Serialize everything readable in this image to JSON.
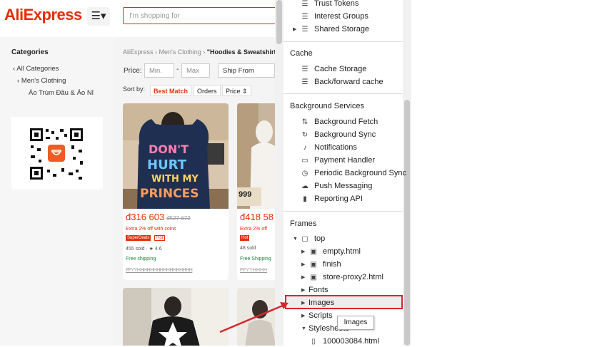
{
  "aliexpress": {
    "logo": "AliExpress",
    "menu_icon": "☰▾",
    "search_placeholder": "I'm shopping for",
    "categories_title": "Categories",
    "all_categories": "All Categories",
    "mens_clothing": "Men's Clothing",
    "subcategory": "Áo Trùm Đầu & Áo Nỉ",
    "breadcrumb": {
      "a": "AliExpress",
      "b": "Men's Clothing",
      "c": "\"Hoodies & Sweatshirts\""
    },
    "price_label": "Price:",
    "price_min": "Min.",
    "price_dash": "-",
    "price_max": "Max",
    "ship_from": "Ship From",
    "sort_by": "Sort by:",
    "sort_best": "Best Match",
    "sort_orders": "Orders",
    "sort_price": "Price ⇕",
    "products": [
      {
        "price": "đ316 603",
        "old_price": "đ527 672",
        "extra": "Extra 2% off with coins",
        "badge": "SuperDeals",
        "pill": "Hot",
        "sold": "455 sold · ★ 4.6",
        "shipping": "Free shipping",
        "title_strip": "FFYYHHHHHHHHHHHHHHHHH",
        "art_text": "DON'T HURT WITH MY PRINCES"
      },
      {
        "price": "đ418 58",
        "extra": "Extra 2% off",
        "badge": "Hot",
        "sold": "48 sold",
        "shipping": "Free Shipping",
        "title_strip": "FFYYHHHH",
        "sticker": "999"
      }
    ]
  },
  "devtools": {
    "storage_items": [
      "Trust Tokens",
      "Interest Groups",
      "Shared Storage"
    ],
    "cache_title": "Cache",
    "cache_items": [
      "Cache Storage",
      "Back/forward cache"
    ],
    "bg_title": "Background Services",
    "bg_items": [
      "Background Fetch",
      "Background Sync",
      "Notifications",
      "Payment Handler",
      "Periodic Background Sync",
      "Push Messaging",
      "Reporting API"
    ],
    "frames_title": "Frames",
    "frame_top": "top",
    "frame_children": [
      "empty.html",
      "finish",
      "store-proxy2.html"
    ],
    "resource_folders": [
      "Fonts",
      "Images",
      "Scripts",
      "Stylesheets"
    ],
    "file_item": "100003084.html",
    "tooltip": "Images"
  },
  "colors": {
    "accent": "#e62e04",
    "highlight_border": "#d9262c"
  }
}
